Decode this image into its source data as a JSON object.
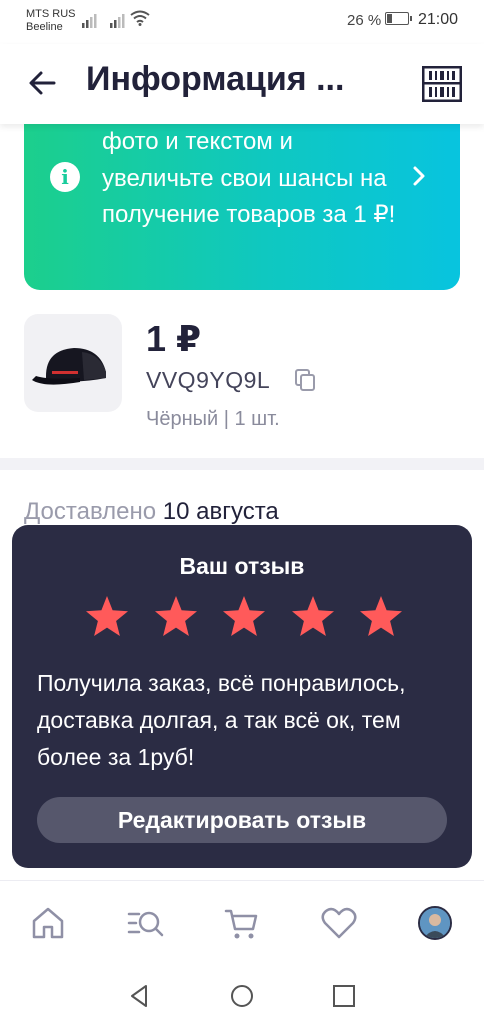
{
  "status_bar": {
    "carrier_line1": "MTS RUS",
    "carrier_line2": "Beeline",
    "battery_percent": "26 %",
    "battery_level": 0.26,
    "time": "21:00"
  },
  "header": {
    "title": "Информация ...",
    "back_icon": "arrow-left-icon",
    "action_icon": "barcode-icon"
  },
  "banner": {
    "text": "фото и текстом и увеличьте свои шансы на получение товаров за 1 ₽!",
    "icon": "info-icon",
    "info_glyph": "i",
    "chevron_icon": "chevron-right-icon",
    "gradient_start": "#1ccf8c",
    "gradient_end": "#08c4df"
  },
  "product": {
    "price": "1 ₽",
    "sku": "VVQ9YQ9L",
    "variant": "Чёрный | 1 шт.",
    "image_icon": "cap-image"
  },
  "delivery": {
    "label": "Доставлено",
    "date": "10 августа"
  },
  "review": {
    "title": "Ваш отзыв",
    "rating": 5,
    "max_rating": 5,
    "star_color": "#ff5a5a",
    "text": "Получила заказ, всё понравилось, доставка долгая, а так всё ок, тем более за 1руб!",
    "edit_button": "Редактировать отзыв"
  },
  "bottom_nav": {
    "items": [
      "home-icon",
      "catalog-search-icon",
      "cart-icon",
      "favorites-heart-icon",
      "profile-avatar"
    ]
  },
  "system_nav": [
    "back-triangle-icon",
    "home-circle-icon",
    "recents-square-icon"
  ]
}
